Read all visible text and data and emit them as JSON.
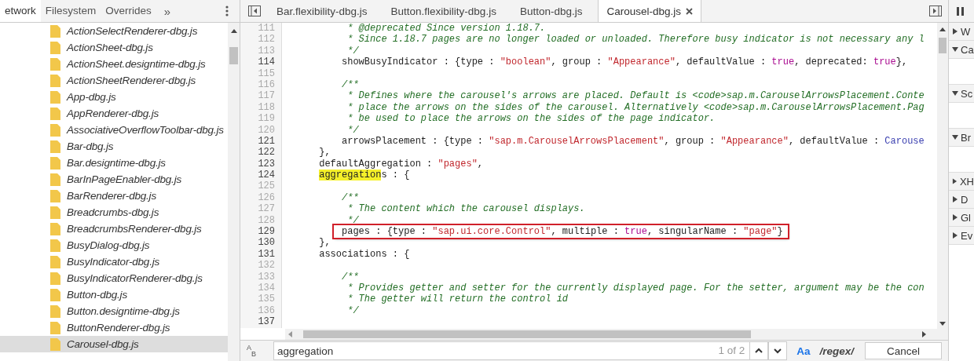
{
  "navigator": {
    "tabs": [
      {
        "label": "etwork",
        "selected": true
      },
      {
        "label": "Filesystem",
        "selected": false
      },
      {
        "label": "Overrides",
        "selected": false
      }
    ],
    "more": "»",
    "files": [
      {
        "name": "ActionSelectRenderer-dbg.js",
        "selected": false
      },
      {
        "name": "ActionSheet-dbg.js",
        "selected": false
      },
      {
        "name": "ActionSheet.designtime-dbg.js",
        "selected": false
      },
      {
        "name": "ActionSheetRenderer-dbg.js",
        "selected": false
      },
      {
        "name": "App-dbg.js",
        "selected": false
      },
      {
        "name": "AppRenderer-dbg.js",
        "selected": false
      },
      {
        "name": "AssociativeOverflowToolbar-dbg.js",
        "selected": false
      },
      {
        "name": "Bar-dbg.js",
        "selected": false
      },
      {
        "name": "Bar.designtime-dbg.js",
        "selected": false
      },
      {
        "name": "BarInPageEnabler-dbg.js",
        "selected": false
      },
      {
        "name": "BarRenderer-dbg.js",
        "selected": false
      },
      {
        "name": "Breadcrumbs-dbg.js",
        "selected": false
      },
      {
        "name": "BreadcrumbsRenderer-dbg.js",
        "selected": false
      },
      {
        "name": "BusyDialog-dbg.js",
        "selected": false
      },
      {
        "name": "BusyIndicator-dbg.js",
        "selected": false
      },
      {
        "name": "BusyIndicatorRenderer-dbg.js",
        "selected": false
      },
      {
        "name": "Button-dbg.js",
        "selected": false
      },
      {
        "name": "Button.designtime-dbg.js",
        "selected": false
      },
      {
        "name": "ButtonRenderer-dbg.js",
        "selected": false
      },
      {
        "name": "Carousel-dbg.js",
        "selected": true
      }
    ]
  },
  "editor": {
    "tabs": [
      {
        "label": "Bar.flexibility-dbg.js",
        "selected": false
      },
      {
        "label": "Button.flexibility-dbg.js",
        "selected": false
      },
      {
        "label": "Button-dbg.js",
        "selected": false
      },
      {
        "label": "Carousel-dbg.js",
        "selected": true
      }
    ],
    "lines": [
      {
        "number": "111",
        "dimmed": true,
        "segments": [
          {
            "kind": "comment",
            "text": "           * @deprecated Since version 1.18.7."
          }
        ]
      },
      {
        "number": "112",
        "dimmed": true,
        "segments": [
          {
            "kind": "comment",
            "text": "           * Since 1.18.7 pages are no longer loaded or unloaded. Therefore busy indicator is not necessary any l"
          }
        ]
      },
      {
        "number": "113",
        "dimmed": true,
        "segments": [
          {
            "kind": "comment",
            "text": "           */"
          }
        ]
      },
      {
        "number": "114",
        "dimmed": false,
        "segments": [
          {
            "kind": "plain",
            "text": "          showBusyIndicator : {type : "
          },
          {
            "kind": "string",
            "text": "\"boolean\""
          },
          {
            "kind": "plain",
            "text": ", group : "
          },
          {
            "kind": "string",
            "text": "\"Appearance\""
          },
          {
            "kind": "plain",
            "text": ", defaultValue : "
          },
          {
            "kind": "keyword",
            "text": "true"
          },
          {
            "kind": "plain",
            "text": ", deprecated: "
          },
          {
            "kind": "keyword",
            "text": "true"
          },
          {
            "kind": "plain",
            "text": "},"
          }
        ]
      },
      {
        "number": "115",
        "dimmed": true
      },
      {
        "number": "116",
        "dimmed": true,
        "segments": [
          {
            "kind": "comment",
            "text": "          /**"
          }
        ]
      },
      {
        "number": "117",
        "dimmed": true,
        "segments": [
          {
            "kind": "comment",
            "text": "           * Defines where the carousel's arrows are placed. Default is <code>sap.m.CarouselArrowsPlacement.Conte"
          }
        ]
      },
      {
        "number": "118",
        "dimmed": true,
        "segments": [
          {
            "kind": "comment",
            "text": "           * place the arrows on the sides of the carousel. Alternatively <code>sap.m.CarouselArrowsPlacement.Pag"
          }
        ]
      },
      {
        "number": "119",
        "dimmed": true,
        "segments": [
          {
            "kind": "comment",
            "text": "           * be used to place the arrows on the sides of the page indicator."
          }
        ]
      },
      {
        "number": "120",
        "dimmed": true,
        "segments": [
          {
            "kind": "comment",
            "text": "           */"
          }
        ]
      },
      {
        "number": "121",
        "dimmed": false,
        "segments": [
          {
            "kind": "plain",
            "text": "          arrowsPlacement : {type : "
          },
          {
            "kind": "string",
            "text": "\"sap.m.CarouselArrowsPlacement\""
          },
          {
            "kind": "plain",
            "text": ", group : "
          },
          {
            "kind": "string",
            "text": "\"Appearance\""
          },
          {
            "kind": "plain",
            "text": ", defaultValue : "
          },
          {
            "kind": "name",
            "text": "Carouse"
          }
        ]
      },
      {
        "number": "122",
        "dimmed": false,
        "segments": [
          {
            "kind": "plain",
            "text": "      },"
          }
        ]
      },
      {
        "number": "123",
        "dimmed": false,
        "segments": [
          {
            "kind": "plain",
            "text": "      defaultAggregation : "
          },
          {
            "kind": "string",
            "text": "\"pages\""
          },
          {
            "kind": "plain",
            "text": ","
          }
        ]
      },
      {
        "number": "124",
        "dimmed": false,
        "segments": [
          {
            "kind": "match",
            "text": "      aggregation"
          },
          {
            "kind": "plain",
            "text": "s : {"
          }
        ]
      },
      {
        "number": "125",
        "dimmed": true
      },
      {
        "number": "126",
        "dimmed": true,
        "segments": [
          {
            "kind": "comment",
            "text": "          /**"
          }
        ]
      },
      {
        "number": "127",
        "dimmed": true,
        "segments": [
          {
            "kind": "comment",
            "text": "           * The content which the carousel displays."
          }
        ]
      },
      {
        "number": "128",
        "dimmed": true,
        "segments": [
          {
            "kind": "comment",
            "text": "           */"
          }
        ]
      },
      {
        "number": "129",
        "dimmed": false,
        "boxed": true,
        "segments": [
          {
            "kind": "plain",
            "text": "          pages : {type : "
          },
          {
            "kind": "string",
            "text": "\"sap.ui.core.Control\""
          },
          {
            "kind": "plain",
            "text": ", multiple : "
          },
          {
            "kind": "keyword",
            "text": "true"
          },
          {
            "kind": "plain",
            "text": ", singularName : "
          },
          {
            "kind": "string",
            "text": "\"page\""
          },
          {
            "kind": "plain",
            "text": "}"
          }
        ]
      },
      {
        "number": "130",
        "dimmed": false,
        "segments": [
          {
            "kind": "plain",
            "text": "      },"
          }
        ]
      },
      {
        "number": "131",
        "dimmed": false,
        "segments": [
          {
            "kind": "plain",
            "text": "      associations : {"
          }
        ]
      },
      {
        "number": "132",
        "dimmed": true
      },
      {
        "number": "133",
        "dimmed": true,
        "segments": [
          {
            "kind": "comment",
            "text": "          /**"
          }
        ]
      },
      {
        "number": "134",
        "dimmed": true,
        "segments": [
          {
            "kind": "comment",
            "text": "           * Provides getter and setter for the currently displayed page. For the setter, argument may be the con"
          }
        ]
      },
      {
        "number": "135",
        "dimmed": true,
        "segments": [
          {
            "kind": "comment",
            "text": "           * The getter will return the control id"
          }
        ]
      },
      {
        "number": "136",
        "dimmed": true,
        "segments": [
          {
            "kind": "comment",
            "text": "           */"
          }
        ]
      },
      {
        "number": "137",
        "dimmed": false
      }
    ]
  },
  "search": {
    "toggle_letters": [
      "A",
      "B"
    ],
    "value": "aggregation",
    "count": "1 of 2",
    "case_toggle": "Aa",
    "regex_toggle": "/regex/",
    "cancel": "Cancel"
  },
  "debugger": {
    "sections": [
      {
        "label": "W",
        "expanded": false
      },
      {
        "label": "Ca",
        "expanded": true
      },
      {
        "label": "Sc",
        "expanded": true
      },
      {
        "label": "Br",
        "expanded": true
      },
      {
        "label": "XH",
        "expanded": false
      },
      {
        "label": "D",
        "expanded": false
      },
      {
        "label": "Gl",
        "expanded": false
      },
      {
        "label": "Ev",
        "expanded": false
      }
    ]
  }
}
